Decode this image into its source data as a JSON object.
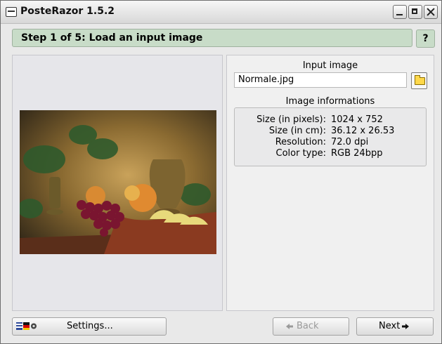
{
  "window": {
    "title": "PosteRazor 1.5.2"
  },
  "step": {
    "title": "Step 1 of 5: Load an input image",
    "help_label": "?"
  },
  "input_image": {
    "label": "Input image",
    "filename": "Normale.jpg"
  },
  "image_info": {
    "label": "Image informations",
    "rows": [
      {
        "key": "Size (in pixels):",
        "value": "1024 x 752"
      },
      {
        "key": "Size (in cm):",
        "value": "36.12 x 26.53"
      },
      {
        "key": "Resolution:",
        "value": "72.0 dpi"
      },
      {
        "key": "Color type:",
        "value": "RGB 24bpp"
      }
    ]
  },
  "buttons": {
    "settings": "Settings...",
    "back": "Back",
    "next": "Next"
  },
  "icons": {
    "app": "app-icon",
    "minimize": "minimize-icon",
    "maximize": "maximize-icon",
    "close": "close-icon",
    "open": "folder-icon",
    "settings": "flags-icon",
    "back": "arrow-left-icon",
    "next": "arrow-right-icon"
  },
  "colors": {
    "step_bar": "#c8dcc8",
    "panel": "#e6e6ea",
    "disabled_text": "#9a9a9a"
  }
}
